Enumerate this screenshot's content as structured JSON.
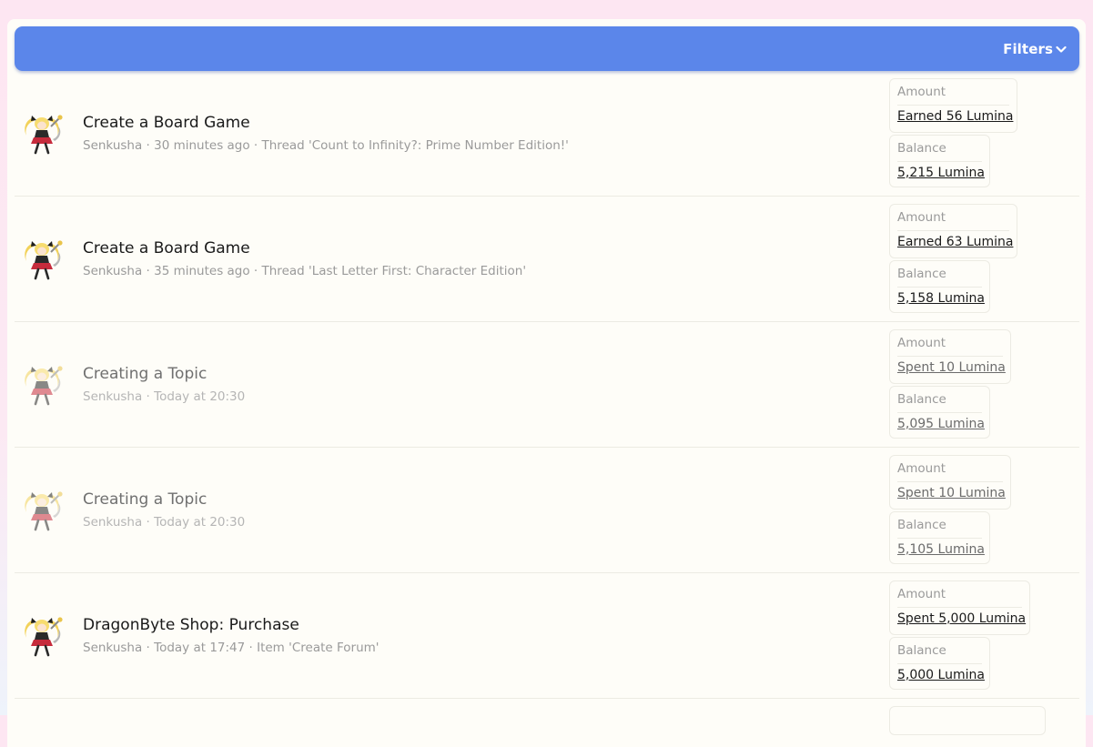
{
  "header": {
    "filters_label": "Filters",
    "accent_color": "#5b86ea"
  },
  "transactions": [
    {
      "title": "Create a Board Game",
      "meta": "Senkusha · 30 minutes ago · Thread 'Count to Infinity?: Prime Number Edition!'",
      "amount_label": "Amount",
      "amount_value": "Earned 56 Lumina",
      "balance_label": "Balance",
      "balance_value": "5,215 Lumina",
      "dimmed": false
    },
    {
      "title": "Create a Board Game",
      "meta": "Senkusha · 35 minutes ago · Thread 'Last Letter First: Character Edition'",
      "amount_label": "Amount",
      "amount_value": "Earned 63 Lumina",
      "balance_label": "Balance",
      "balance_value": "5,158 Lumina",
      "dimmed": false
    },
    {
      "title": "Creating a Topic",
      "meta": "Senkusha · Today at 20:30",
      "amount_label": "Amount",
      "amount_value": "Spent 10 Lumina",
      "balance_label": "Balance",
      "balance_value": "5,095 Lumina",
      "dimmed": true
    },
    {
      "title": "Creating a Topic",
      "meta": "Senkusha · Today at 20:30",
      "amount_label": "Amount",
      "amount_value": "Spent 10 Lumina",
      "balance_label": "Balance",
      "balance_value": "5,105 Lumina",
      "dimmed": true
    },
    {
      "title": "DragonByte Shop: Purchase",
      "meta": "Senkusha · Today at 17:47 · Item 'Create Forum'",
      "amount_label": "Amount",
      "amount_value": "Spent 5,000 Lumina",
      "balance_label": "Balance",
      "balance_value": "5,000 Lumina",
      "dimmed": false
    }
  ]
}
